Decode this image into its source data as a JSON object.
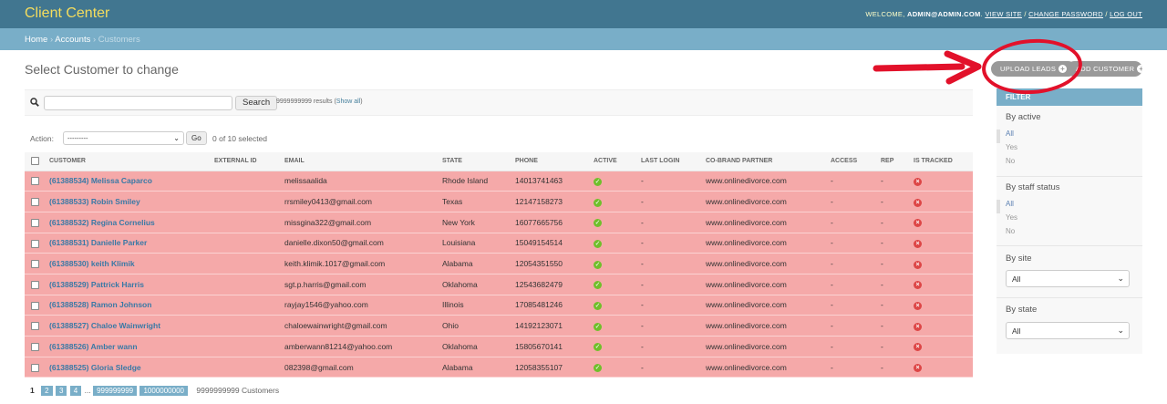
{
  "header": {
    "brand": "Client Center",
    "welcome": "WELCOME,",
    "user": "ADMIN@ADMIN.COM",
    "view_site": "VIEW SITE",
    "change_password": "CHANGE PASSWORD",
    "log_out": "LOG OUT"
  },
  "breadcrumbs": {
    "home": "Home",
    "app": "Accounts",
    "current": "Customers"
  },
  "page_title": "Select Customer to change",
  "object_tools": {
    "upload_leads": "UPLOAD LEADS",
    "add_customer": "ADD CUSTOMER"
  },
  "search": {
    "button": "Search",
    "results": "9999999999 results (",
    "show_all": "Show all",
    "close_paren": ")"
  },
  "actions": {
    "label": "Action:",
    "selected": "---------",
    "go": "Go",
    "count": "0 of 10 selected"
  },
  "table": {
    "columns": [
      "Customer",
      "External ID",
      "Email",
      "State",
      "Phone",
      "Active",
      "Last login",
      "Co-brand partner",
      "Access",
      "Rep",
      "Is tracked"
    ],
    "rows": [
      {
        "customer": "(61388534) Melissa Caparco",
        "external_id": "",
        "email": "melissaalida",
        "state": "Rhode Island",
        "phone": "14013741463",
        "last_login": "-",
        "partner": "www.onlinedivorce.com",
        "access": "-",
        "rep": "-"
      },
      {
        "customer": "(61388533) Robin Smiley",
        "external_id": "",
        "email": "rrsmiley0413@gmail.com",
        "state": "Texas",
        "phone": "12147158273",
        "last_login": "-",
        "partner": "www.onlinedivorce.com",
        "access": "-",
        "rep": "-"
      },
      {
        "customer": "(61388532) Regina Cornelius",
        "external_id": "",
        "email": "missgina322@gmail.com",
        "state": "New York",
        "phone": "16077665756",
        "last_login": "-",
        "partner": "www.onlinedivorce.com",
        "access": "-",
        "rep": "-"
      },
      {
        "customer": "(61388531) Danielle Parker",
        "external_id": "",
        "email": "danielle.dixon50@gmail.com",
        "state": "Louisiana",
        "phone": "15049154514",
        "last_login": "-",
        "partner": "www.onlinedivorce.com",
        "access": "-",
        "rep": "-"
      },
      {
        "customer": "(61388530) keith Klimik",
        "external_id": "",
        "email": "keith.klimik.1017@gmail.com",
        "state": "Alabama",
        "phone": "12054351550",
        "last_login": "-",
        "partner": "www.onlinedivorce.com",
        "access": "-",
        "rep": "-"
      },
      {
        "customer": "(61388529) Pattrick Harris",
        "external_id": "",
        "email": "sgt.p.harris@gmail.com",
        "state": "Oklahoma",
        "phone": "12543682479",
        "last_login": "-",
        "partner": "www.onlinedivorce.com",
        "access": "-",
        "rep": "-"
      },
      {
        "customer": "(61388528) Ramon Johnson",
        "external_id": "",
        "email": "rayjay1546@yahoo.com",
        "state": "Illinois",
        "phone": "17085481246",
        "last_login": "-",
        "partner": "www.onlinedivorce.com",
        "access": "-",
        "rep": "-"
      },
      {
        "customer": "(61388527) Chaloe Wainwright",
        "external_id": "",
        "email": "chaloewainwright@gmail.com",
        "state": "Ohio",
        "phone": "14192123071",
        "last_login": "-",
        "partner": "www.onlinedivorce.com",
        "access": "-",
        "rep": "-"
      },
      {
        "customer": "(61388526) Amber wann",
        "external_id": "",
        "email": "amberwann81214@yahoo.com",
        "state": "Oklahoma",
        "phone": "15805670141",
        "last_login": "-",
        "partner": "www.onlinedivorce.com",
        "access": "-",
        "rep": "-"
      },
      {
        "customer": "(61388525) Gloria Sledge",
        "external_id": "",
        "email": "082398@gmail.com",
        "state": "Alabama",
        "phone": "12058355107",
        "last_login": "-",
        "partner": "www.onlinedivorce.com",
        "access": "-",
        "rep": "-"
      }
    ]
  },
  "paginator": {
    "current": "1",
    "pages": [
      "2",
      "3",
      "4"
    ],
    "ellipsis": "...",
    "last_pages": [
      "999999999",
      "1000000000"
    ],
    "total": "9999999999 Customers"
  },
  "filter": {
    "title": "FILTER",
    "by_active": {
      "title": "By active",
      "options": [
        "All",
        "Yes",
        "No"
      ]
    },
    "by_staff": {
      "title": "By staff status",
      "options": [
        "All",
        "Yes",
        "No"
      ]
    },
    "by_site": {
      "title": "By site",
      "value": "All"
    },
    "by_state": {
      "title": "By state",
      "value": "All"
    }
  },
  "colors": {
    "header": "#417690",
    "breadcrumbs": "#79aec8",
    "brand": "#f5dd5d",
    "row_highlight": "#f5a9a9",
    "annotation": "#e2112a",
    "link": "#3879a6"
  },
  "icons": {
    "active": "check-circle-icon",
    "tracked": "x-circle-icon",
    "search": "search-icon",
    "add": "plus-icon"
  }
}
